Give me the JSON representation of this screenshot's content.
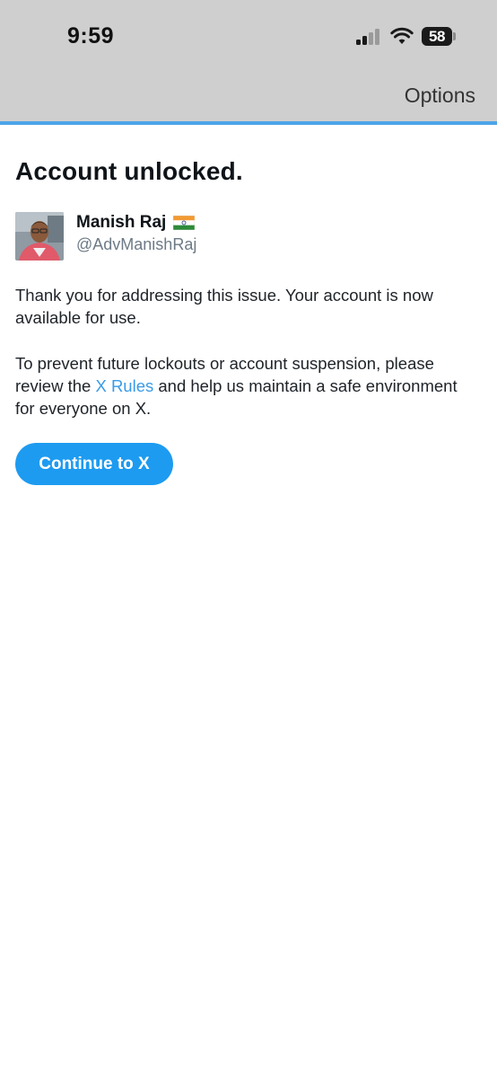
{
  "status_bar": {
    "time": "9:59",
    "battery_level": "58",
    "signal_icon": "cellular-signal-icon",
    "wifi_icon": "wifi-icon"
  },
  "nav": {
    "options_label": "Options"
  },
  "main": {
    "title": "Account unlocked.",
    "user": {
      "name": "Manish Raj",
      "flag_icon": "india-flag-icon",
      "handle": "@AdvManishRaj"
    },
    "paragraph1": "Thank you for addressing this issue. Your account is now available for use.",
    "paragraph2": {
      "before_link": "To prevent future lockouts or account suspension, please review the ",
      "link_text": "X Rules",
      "after_link": " and help us maintain a safe environment for everyone on X."
    },
    "continue_button": "Continue to X"
  },
  "colors": {
    "accent": "#1d9bf0",
    "link": "#3a9be8",
    "header_bg": "#cfcfcf",
    "header_line": "#4ea4e8"
  }
}
